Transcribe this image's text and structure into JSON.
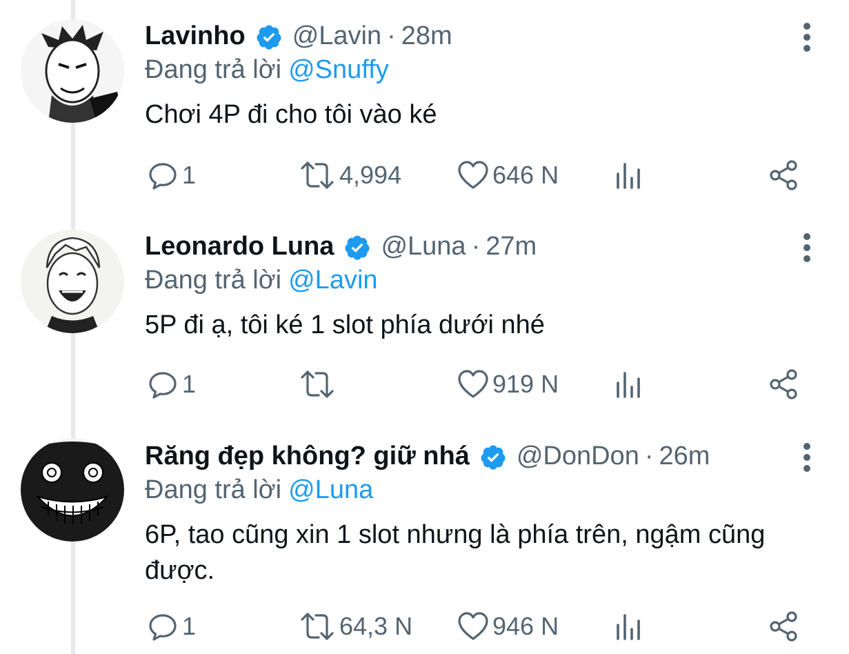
{
  "colors": {
    "accent": "#1d9bf0",
    "text_primary": "#0f1419",
    "text_secondary": "#536471",
    "thread_line": "#e6e8eb"
  },
  "icons": {
    "more": "more-vertical-icon",
    "verified": "verified-badge-icon",
    "reply": "reply-bubble-icon",
    "retweet": "retweet-icon",
    "like": "heart-icon",
    "analytics": "bar-chart-icon",
    "share": "share-icon"
  },
  "replying_label": "Đang trả lời",
  "tweets": [
    {
      "name": "Lavinho",
      "handle": "@Lavin",
      "separator": "·",
      "time": "28m",
      "reply_to": "@Snuffy",
      "text": "Chơi 4P đi cho tôi vào ké",
      "replies": "1",
      "retweets": "4,994",
      "likes": "646 N"
    },
    {
      "name": "Leonardo Luna",
      "handle": "@Luna",
      "separator": "·",
      "time": "27m",
      "reply_to": "@Lavin",
      "text": "5P đi ạ, tôi ké 1 slot phía dưới nhé",
      "replies": "1",
      "retweets": "",
      "likes": "919 N"
    },
    {
      "name": "Răng đẹp không? giữ nhá",
      "handle": "@DonDon",
      "separator": "·",
      "time": "26m",
      "reply_to": "@Luna",
      "text": "6P, tao cũng xin 1 slot nhưng là phía trên, ngậm cũng được.",
      "replies": "1",
      "retweets": "64,3 N",
      "likes": "946 N"
    }
  ]
}
